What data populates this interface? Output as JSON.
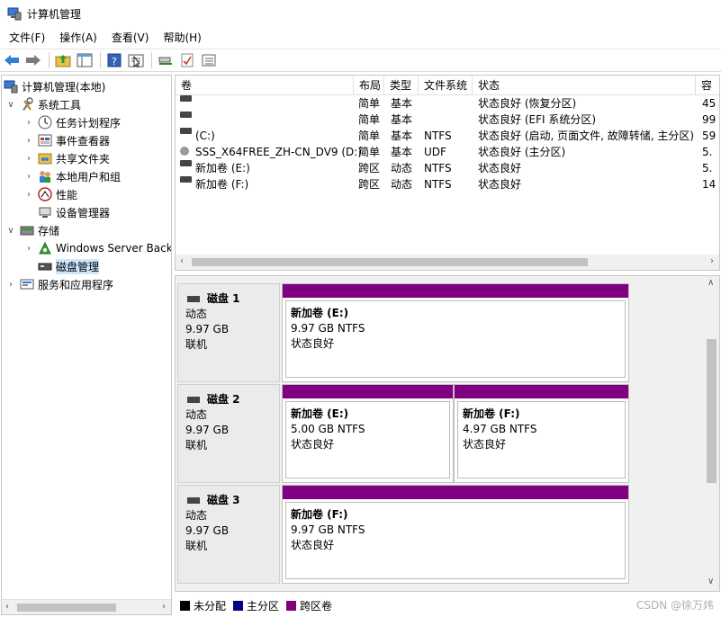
{
  "window": {
    "title": "计算机管理"
  },
  "menu": [
    "文件(F)",
    "操作(A)",
    "查看(V)",
    "帮助(H)"
  ],
  "tree": {
    "root": "计算机管理(本地)",
    "system_tools": "系统工具",
    "task_scheduler": "任务计划程序",
    "event_viewer": "事件查看器",
    "shared_folders": "共享文件夹",
    "local_users": "本地用户和组",
    "performance": "性能",
    "device_manager": "设备管理器",
    "storage": "存储",
    "windows_server_backup": "Windows Server Back",
    "disk_management": "磁盘管理",
    "services_apps": "服务和应用程序"
  },
  "columns": {
    "volume": "卷",
    "layout": "布局",
    "type": "类型",
    "fs": "文件系统",
    "status": "状态",
    "capacity": "容"
  },
  "volumes": [
    {
      "name": "",
      "layout": "简单",
      "type": "基本",
      "fs": "",
      "status": "状态良好 (恢复分区)",
      "capacity": "45"
    },
    {
      "name": "",
      "layout": "简单",
      "type": "基本",
      "fs": "",
      "status": "状态良好 (EFI 系统分区)",
      "capacity": "99"
    },
    {
      "name": "(C:)",
      "layout": "简单",
      "type": "基本",
      "fs": "NTFS",
      "status": "状态良好 (启动, 页面文件, 故障转储, 主分区)",
      "capacity": "59"
    },
    {
      "name": "SSS_X64FREE_ZH-CN_DV9 (D:)",
      "layout": "简单",
      "type": "基本",
      "fs": "UDF",
      "status": "状态良好 (主分区)",
      "capacity": "5."
    },
    {
      "name": "新加卷 (E:)",
      "layout": "跨区",
      "type": "动态",
      "fs": "NTFS",
      "status": "状态良好",
      "capacity": "5."
    },
    {
      "name": "新加卷 (F:)",
      "layout": "跨区",
      "type": "动态",
      "fs": "NTFS",
      "status": "状态良好",
      "capacity": "14"
    }
  ],
  "disks": [
    {
      "name": "磁盘 1",
      "type": "动态",
      "size": "9.97 GB",
      "state": "联机",
      "partitions": [
        {
          "name": "新加卷  (E:)",
          "size": "9.97 GB NTFS",
          "status": "状态良好"
        }
      ]
    },
    {
      "name": "磁盘 2",
      "type": "动态",
      "size": "9.97 GB",
      "state": "联机",
      "partitions": [
        {
          "name": "新加卷  (E:)",
          "size": "5.00 GB NTFS",
          "status": "状态良好"
        },
        {
          "name": "新加卷  (F:)",
          "size": "4.97 GB NTFS",
          "status": "状态良好"
        }
      ]
    },
    {
      "name": "磁盘 3",
      "type": "动态",
      "size": "9.97 GB",
      "state": "联机",
      "partitions": [
        {
          "name": "新加卷  (F:)",
          "size": "9.97 GB NTFS",
          "status": "状态良好"
        }
      ]
    }
  ],
  "legend": [
    {
      "label": "未分配",
      "color": "#000000"
    },
    {
      "label": "主分区",
      "color": "#000080"
    },
    {
      "label": "跨区卷",
      "color": "#800080"
    }
  ],
  "watermark": "CSDN @徐万炜"
}
